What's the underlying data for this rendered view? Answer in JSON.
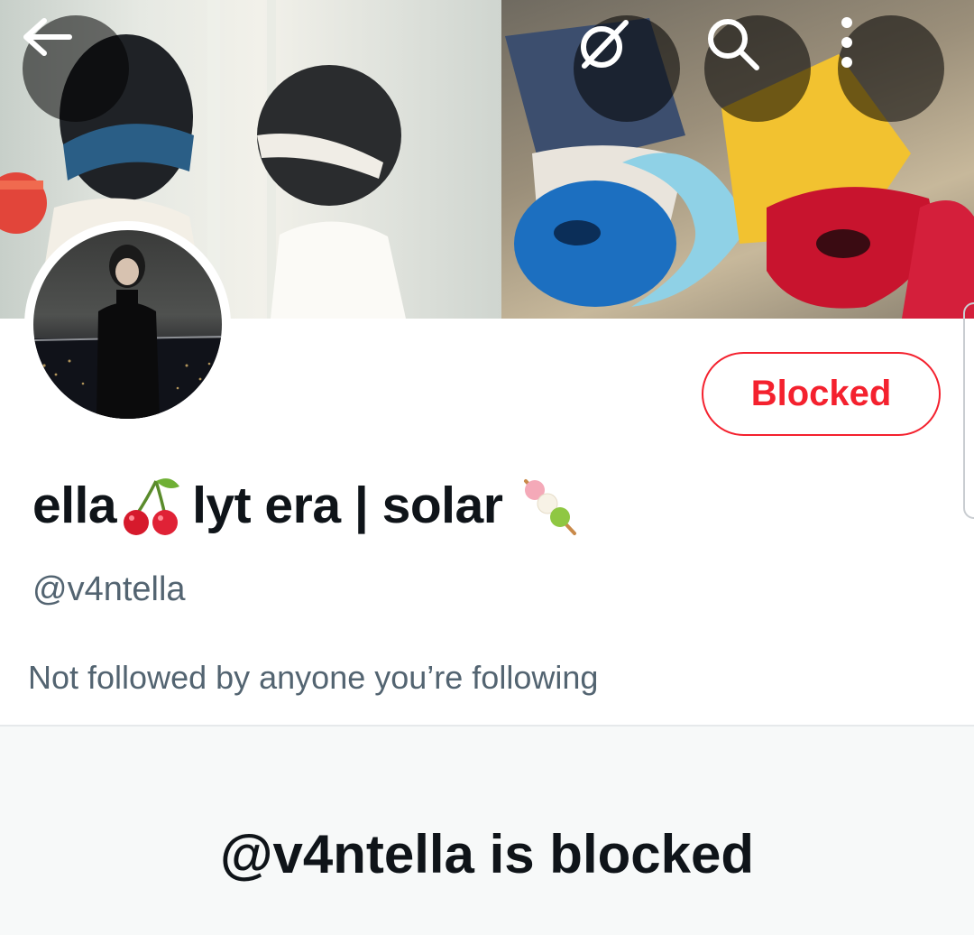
{
  "profile": {
    "display_name_prefix": "ella",
    "display_name_suffix": "lyt era | solar",
    "name_emoji_1": "cherries-emoji",
    "name_emoji_2": "dango-emoji",
    "handle": "@v4ntella",
    "followers_note": "Not followed by anyone you’re following",
    "action_button_label": "Blocked"
  },
  "header": {
    "back_icon": "back-arrow-icon",
    "grok_icon": "grok-icon",
    "search_icon": "search-icon",
    "more_icon": "more-vertical-icon"
  },
  "blocked_state": {
    "heading": "@v4ntella is blocked"
  },
  "colors": {
    "danger": "#f4212e",
    "text_primary": "#0f1419",
    "text_secondary": "#536471",
    "muted_bg": "#f7f9f9"
  }
}
